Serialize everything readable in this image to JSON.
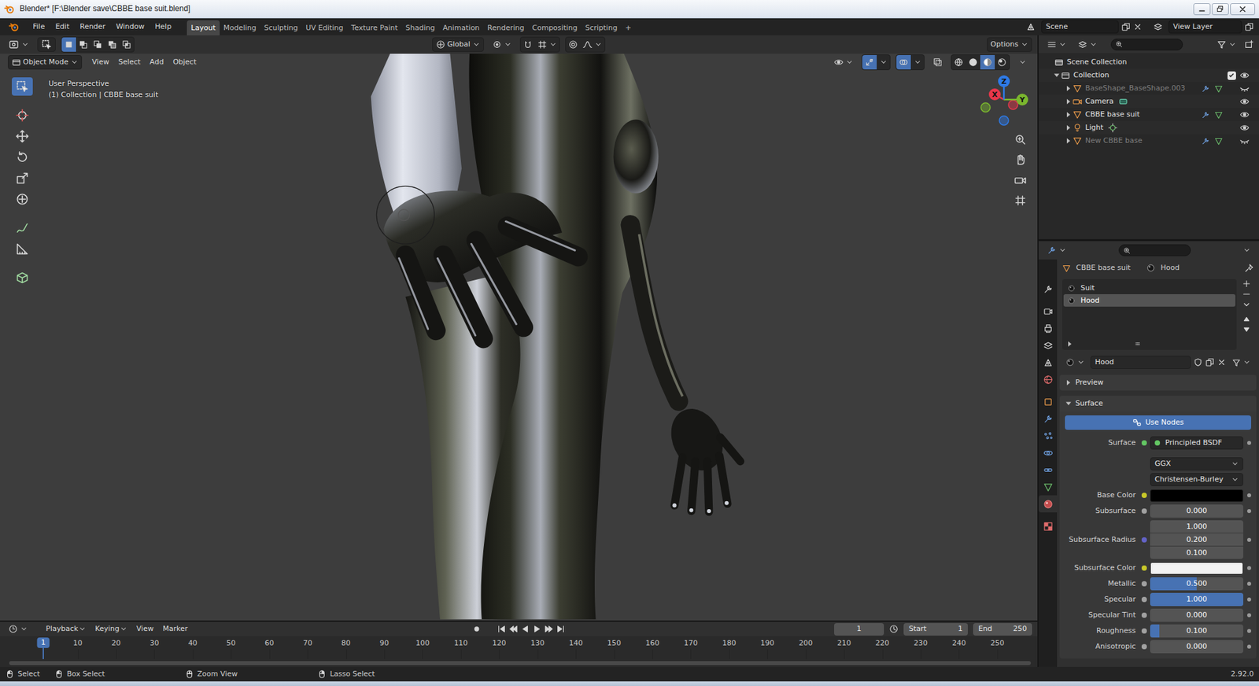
{
  "window": {
    "title": "Blender* [F:\\Blender save\\CBBE base suit.blend]"
  },
  "menu": [
    "File",
    "Edit",
    "Render",
    "Window",
    "Help"
  ],
  "workspaces": [
    {
      "label": "Layout",
      "selected": true
    },
    {
      "label": "Modeling",
      "selected": false
    },
    {
      "label": "Sculpting",
      "selected": false
    },
    {
      "label": "UV Editing",
      "selected": false
    },
    {
      "label": "Texture Paint",
      "selected": false
    },
    {
      "label": "Shading",
      "selected": false
    },
    {
      "label": "Animation",
      "selected": false
    },
    {
      "label": "Rendering",
      "selected": false
    },
    {
      "label": "Compositing",
      "selected": false
    },
    {
      "label": "Scripting",
      "selected": false
    }
  ],
  "add_workspace": "+",
  "scene": "Scene",
  "view_layer": "View Layer",
  "tool_header": {
    "select_modes": [
      {
        "selected": true
      },
      {
        "selected": false
      },
      {
        "selected": false
      },
      {
        "selected": false
      },
      {
        "selected": false
      }
    ],
    "orientation": "Global",
    "options": "Options"
  },
  "viewport": {
    "mode": "Object Mode",
    "menus": [
      "View",
      "Select",
      "Add",
      "Object"
    ],
    "perspective": "User Perspective",
    "context": "(1) Collection | CBBE base suit",
    "shading": [
      {
        "selected": false
      },
      {
        "selected": false
      },
      {
        "selected": true
      },
      {
        "selected": false
      }
    ],
    "tools": [
      {
        "selected": true
      },
      {
        "selected": false
      },
      {
        "selected": false
      },
      {
        "selected": false
      },
      {
        "selected": false
      },
      {
        "selected": false
      },
      {
        "selected": false
      },
      {
        "selected": false
      },
      {
        "selected": false
      }
    ],
    "gizmo": [
      {
        "label": "X",
        "color": "#e8374b"
      },
      {
        "label": "Y",
        "color": "#7bb72e"
      },
      {
        "label": "Z",
        "color": "#2e7be8"
      }
    ]
  },
  "timeline": {
    "menus": [
      "Playback",
      "Keying",
      "View",
      "Marker"
    ],
    "frame": "1",
    "start_label": "Start",
    "start": "1",
    "end_label": "End",
    "end": "250",
    "playhead": "1",
    "ticks": [
      "10",
      "20",
      "30",
      "40",
      "50",
      "60",
      "70",
      "80",
      "90",
      "100",
      "110",
      "120",
      "130",
      "140",
      "150",
      "160",
      "170",
      "180",
      "190",
      "200",
      "210",
      "220",
      "230",
      "240",
      "250"
    ]
  },
  "outliner": {
    "root": "Scene Collection",
    "collection": {
      "label": "Collection",
      "expanded": true,
      "checked": true,
      "visible": true
    },
    "items": [
      {
        "label": "BaseShape_BaseShape.003",
        "kind": "mesh",
        "expanded": false,
        "visible": false
      },
      {
        "label": "Camera",
        "kind": "camera",
        "expanded": false,
        "visible": true
      },
      {
        "label": "CBBE base suit",
        "kind": "mesh",
        "expanded": false,
        "visible": true
      },
      {
        "label": "Light",
        "kind": "light",
        "expanded": false,
        "visible": true
      },
      {
        "label": "New CBBE base",
        "kind": "mesh",
        "expanded": false,
        "visible": false
      }
    ]
  },
  "properties": {
    "tabs": [
      {
        "selected": false
      },
      {
        "selected": false
      },
      {
        "selected": false
      },
      {
        "selected": false
      },
      {
        "selected": false
      },
      {
        "selected": false
      },
      {
        "selected": false
      },
      {
        "selected": false
      },
      {
        "selected": false
      },
      {
        "selected": false
      },
      {
        "selected": false
      },
      {
        "selected": false
      },
      {
        "selected": true
      },
      {
        "selected": false
      }
    ],
    "object": "CBBE base suit",
    "material": "Hood",
    "slots": [
      {
        "label": "Suit",
        "selected": false
      },
      {
        "label": "Hood",
        "selected": true
      }
    ],
    "material_name": "Hood",
    "panels": [
      {
        "label": "Preview",
        "expanded": false
      },
      {
        "label": "Surface",
        "expanded": true
      }
    ],
    "use_nodes": "Use Nodes",
    "rows": [
      {
        "kind": "shader",
        "label": "Surface",
        "value": "Principled BSDF"
      },
      {
        "kind": "menu",
        "value": "GGX"
      },
      {
        "kind": "menu",
        "value": "Christensen-Burley"
      },
      {
        "kind": "color",
        "label": "Base Color",
        "color": "#000000"
      },
      {
        "kind": "slider",
        "label": "Subsurface",
        "value": "0.000",
        "level": 0
      },
      {
        "kind": "vector",
        "label": "Subsurface Radius",
        "values": [
          "1.000",
          "0.200",
          "0.100"
        ]
      },
      {
        "kind": "color",
        "label": "Subsurface Color",
        "color": "#f2f2f2"
      },
      {
        "kind": "slider",
        "label": "Metallic",
        "value": "0.500",
        "level": 0.5
      },
      {
        "kind": "slider",
        "label": "Specular",
        "value": "1.000",
        "level": 1
      },
      {
        "kind": "slider",
        "label": "Specular Tint",
        "value": "0.000",
        "level": 0
      },
      {
        "kind": "slider",
        "label": "Roughness",
        "value": "0.100",
        "level": 0.1
      },
      {
        "kind": "slider",
        "label": "Anisotropic",
        "value": "0.000",
        "level": 0
      }
    ]
  },
  "status_bar": {
    "items": [
      "Select",
      "Box Select",
      "Zoom View",
      "Lasso Select"
    ],
    "version": "2.92.0"
  }
}
